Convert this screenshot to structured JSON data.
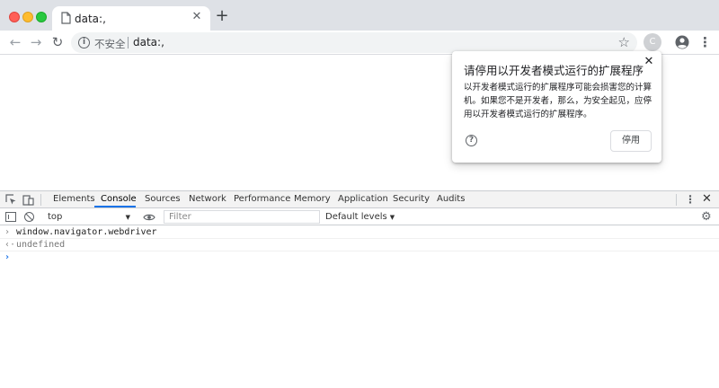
{
  "browser": {
    "tab": {
      "title": "data:,"
    },
    "omnibox": {
      "security_label": "不安全",
      "url": "data:,"
    },
    "extension_avatar_letter": "C"
  },
  "extension_popup": {
    "title": "请停用以开发者模式运行的扩展程序",
    "body": "以开发者模式运行的扩展程序可能会损害您的计算机。如果您不是开发者，那么，为安全起见，应停用以开发者模式运行的扩展程序。",
    "disable_label": "停用"
  },
  "devtools": {
    "tabs": [
      "Elements",
      "Console",
      "Sources",
      "Network",
      "Performance",
      "Memory",
      "Application",
      "Security",
      "Audits"
    ],
    "active_tab": "Console",
    "console_bar": {
      "context": "top",
      "filter_placeholder": "Filter",
      "levels_label": "Default levels"
    },
    "console_lines": [
      {
        "kind": "input",
        "text": "window.navigator.webdriver"
      },
      {
        "kind": "result",
        "text": "undefined"
      }
    ]
  },
  "colors": {
    "accent": "#1a73e8",
    "tabstrip": "#dee1e6",
    "traffic_red": "#ff5f57",
    "traffic_yellow": "#febc2e",
    "traffic_green": "#28c840"
  }
}
